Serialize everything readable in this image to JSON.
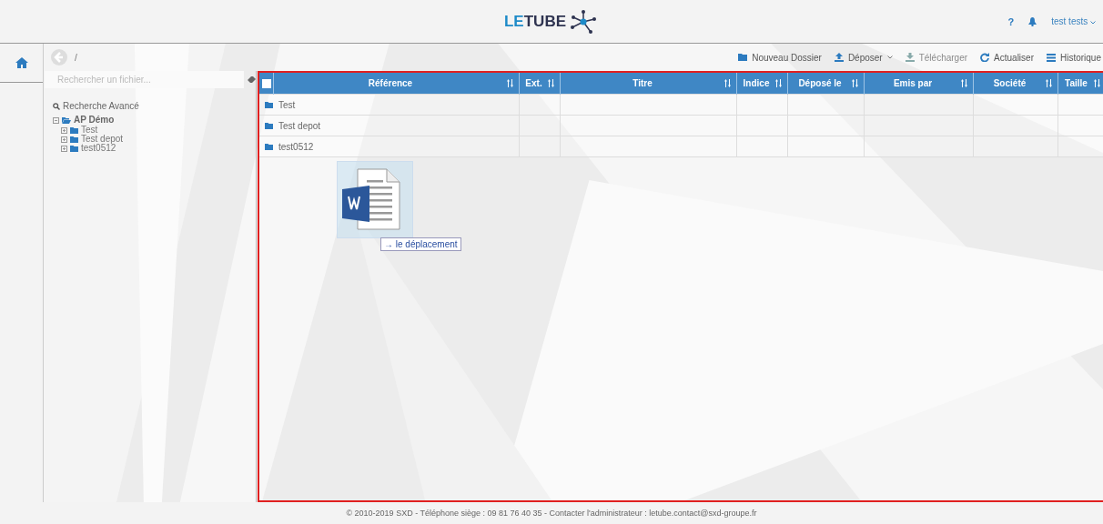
{
  "header": {
    "logo_lead": "LE",
    "logo_rest": "TUBE",
    "help": "?",
    "user": "test tests"
  },
  "breadcrumb": "/",
  "search": {
    "placeholder": "Rechercher un fichier..."
  },
  "advanced_search": "Recherche Avancé",
  "tree": [
    {
      "label": "AP Démo",
      "expanded": true,
      "children": [
        {
          "label": "Test",
          "expanded": false
        },
        {
          "label": "Test depot",
          "expanded": false
        },
        {
          "label": "test0512",
          "expanded": false
        }
      ]
    }
  ],
  "toolbar": [
    {
      "label": "Nouveau Dossier",
      "kind": "folder",
      "disabled": false
    },
    {
      "label": "Déposer",
      "kind": "upload",
      "disabled": false,
      "dropdown": true
    },
    {
      "label": "Télécharger",
      "kind": "download",
      "disabled": true
    },
    {
      "label": "Actualiser",
      "kind": "refresh",
      "disabled": false
    },
    {
      "label": "Historique",
      "kind": "list",
      "disabled": false
    }
  ],
  "table": {
    "select_all": false,
    "columns": [
      {
        "label": "Référence",
        "sortable": true
      },
      {
        "label": "Ext.",
        "sortable": true
      },
      {
        "label": "Titre",
        "sortable": true
      },
      {
        "label": "Indice",
        "sortable": true
      },
      {
        "label": "Déposé le",
        "sortable": true
      },
      {
        "label": "Emis par",
        "sortable": true
      },
      {
        "label": "Société",
        "sortable": true
      },
      {
        "label": "Taille",
        "sortable": true
      }
    ],
    "rows": [
      {
        "name": "Test"
      },
      {
        "name": "Test depot"
      },
      {
        "name": "test0512"
      }
    ]
  },
  "drag": {
    "tooltip": "→ le déplacement"
  },
  "footer": "© 2010-2019 SXD - Téléphone siège : 09 81 76 40 35 - Contacter l'administrateur : letube.contact@sxd-groupe.fr"
}
